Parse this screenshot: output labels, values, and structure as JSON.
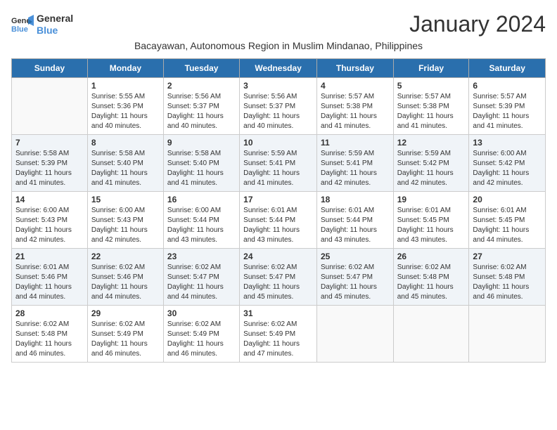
{
  "logo": {
    "line1": "General",
    "line2": "Blue"
  },
  "title": "January 2024",
  "subtitle": "Bacayawan, Autonomous Region in Muslim Mindanao, Philippines",
  "days_of_week": [
    "Sunday",
    "Monday",
    "Tuesday",
    "Wednesday",
    "Thursday",
    "Friday",
    "Saturday"
  ],
  "weeks": [
    [
      {
        "day": "",
        "info": ""
      },
      {
        "day": "1",
        "info": "Sunrise: 5:55 AM\nSunset: 5:36 PM\nDaylight: 11 hours\nand 40 minutes."
      },
      {
        "day": "2",
        "info": "Sunrise: 5:56 AM\nSunset: 5:37 PM\nDaylight: 11 hours\nand 40 minutes."
      },
      {
        "day": "3",
        "info": "Sunrise: 5:56 AM\nSunset: 5:37 PM\nDaylight: 11 hours\nand 40 minutes."
      },
      {
        "day": "4",
        "info": "Sunrise: 5:57 AM\nSunset: 5:38 PM\nDaylight: 11 hours\nand 41 minutes."
      },
      {
        "day": "5",
        "info": "Sunrise: 5:57 AM\nSunset: 5:38 PM\nDaylight: 11 hours\nand 41 minutes."
      },
      {
        "day": "6",
        "info": "Sunrise: 5:57 AM\nSunset: 5:39 PM\nDaylight: 11 hours\nand 41 minutes."
      }
    ],
    [
      {
        "day": "7",
        "info": "Sunrise: 5:58 AM\nSunset: 5:39 PM\nDaylight: 11 hours\nand 41 minutes."
      },
      {
        "day": "8",
        "info": "Sunrise: 5:58 AM\nSunset: 5:40 PM\nDaylight: 11 hours\nand 41 minutes."
      },
      {
        "day": "9",
        "info": "Sunrise: 5:58 AM\nSunset: 5:40 PM\nDaylight: 11 hours\nand 41 minutes."
      },
      {
        "day": "10",
        "info": "Sunrise: 5:59 AM\nSunset: 5:41 PM\nDaylight: 11 hours\nand 41 minutes."
      },
      {
        "day": "11",
        "info": "Sunrise: 5:59 AM\nSunset: 5:41 PM\nDaylight: 11 hours\nand 42 minutes."
      },
      {
        "day": "12",
        "info": "Sunrise: 5:59 AM\nSunset: 5:42 PM\nDaylight: 11 hours\nand 42 minutes."
      },
      {
        "day": "13",
        "info": "Sunrise: 6:00 AM\nSunset: 5:42 PM\nDaylight: 11 hours\nand 42 minutes."
      }
    ],
    [
      {
        "day": "14",
        "info": "Sunrise: 6:00 AM\nSunset: 5:43 PM\nDaylight: 11 hours\nand 42 minutes."
      },
      {
        "day": "15",
        "info": "Sunrise: 6:00 AM\nSunset: 5:43 PM\nDaylight: 11 hours\nand 42 minutes."
      },
      {
        "day": "16",
        "info": "Sunrise: 6:00 AM\nSunset: 5:44 PM\nDaylight: 11 hours\nand 43 minutes."
      },
      {
        "day": "17",
        "info": "Sunrise: 6:01 AM\nSunset: 5:44 PM\nDaylight: 11 hours\nand 43 minutes."
      },
      {
        "day": "18",
        "info": "Sunrise: 6:01 AM\nSunset: 5:44 PM\nDaylight: 11 hours\nand 43 minutes."
      },
      {
        "day": "19",
        "info": "Sunrise: 6:01 AM\nSunset: 5:45 PM\nDaylight: 11 hours\nand 43 minutes."
      },
      {
        "day": "20",
        "info": "Sunrise: 6:01 AM\nSunset: 5:45 PM\nDaylight: 11 hours\nand 44 minutes."
      }
    ],
    [
      {
        "day": "21",
        "info": "Sunrise: 6:01 AM\nSunset: 5:46 PM\nDaylight: 11 hours\nand 44 minutes."
      },
      {
        "day": "22",
        "info": "Sunrise: 6:02 AM\nSunset: 5:46 PM\nDaylight: 11 hours\nand 44 minutes."
      },
      {
        "day": "23",
        "info": "Sunrise: 6:02 AM\nSunset: 5:47 PM\nDaylight: 11 hours\nand 44 minutes."
      },
      {
        "day": "24",
        "info": "Sunrise: 6:02 AM\nSunset: 5:47 PM\nDaylight: 11 hours\nand 45 minutes."
      },
      {
        "day": "25",
        "info": "Sunrise: 6:02 AM\nSunset: 5:47 PM\nDaylight: 11 hours\nand 45 minutes."
      },
      {
        "day": "26",
        "info": "Sunrise: 6:02 AM\nSunset: 5:48 PM\nDaylight: 11 hours\nand 45 minutes."
      },
      {
        "day": "27",
        "info": "Sunrise: 6:02 AM\nSunset: 5:48 PM\nDaylight: 11 hours\nand 46 minutes."
      }
    ],
    [
      {
        "day": "28",
        "info": "Sunrise: 6:02 AM\nSunset: 5:48 PM\nDaylight: 11 hours\nand 46 minutes."
      },
      {
        "day": "29",
        "info": "Sunrise: 6:02 AM\nSunset: 5:49 PM\nDaylight: 11 hours\nand 46 minutes."
      },
      {
        "day": "30",
        "info": "Sunrise: 6:02 AM\nSunset: 5:49 PM\nDaylight: 11 hours\nand 46 minutes."
      },
      {
        "day": "31",
        "info": "Sunrise: 6:02 AM\nSunset: 5:49 PM\nDaylight: 11 hours\nand 47 minutes."
      },
      {
        "day": "",
        "info": ""
      },
      {
        "day": "",
        "info": ""
      },
      {
        "day": "",
        "info": ""
      }
    ]
  ]
}
